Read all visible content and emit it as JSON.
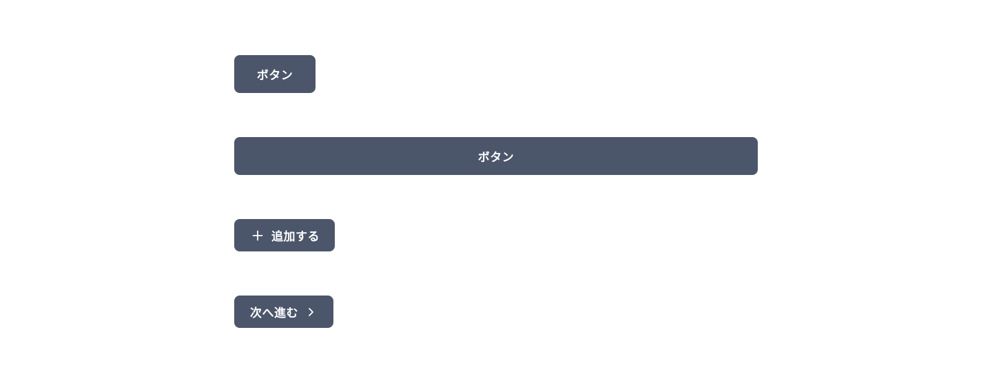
{
  "buttons": {
    "default": {
      "label": "ボタン"
    },
    "full_width": {
      "label": "ボタン"
    },
    "add": {
      "label": "追加する",
      "icon": "plus-icon"
    },
    "next": {
      "label": "次へ進む",
      "icon": "chevron-right-icon"
    }
  },
  "colors": {
    "background": "#ffffff",
    "button_background": "#4b566b",
    "button_text": "#ffffff"
  }
}
